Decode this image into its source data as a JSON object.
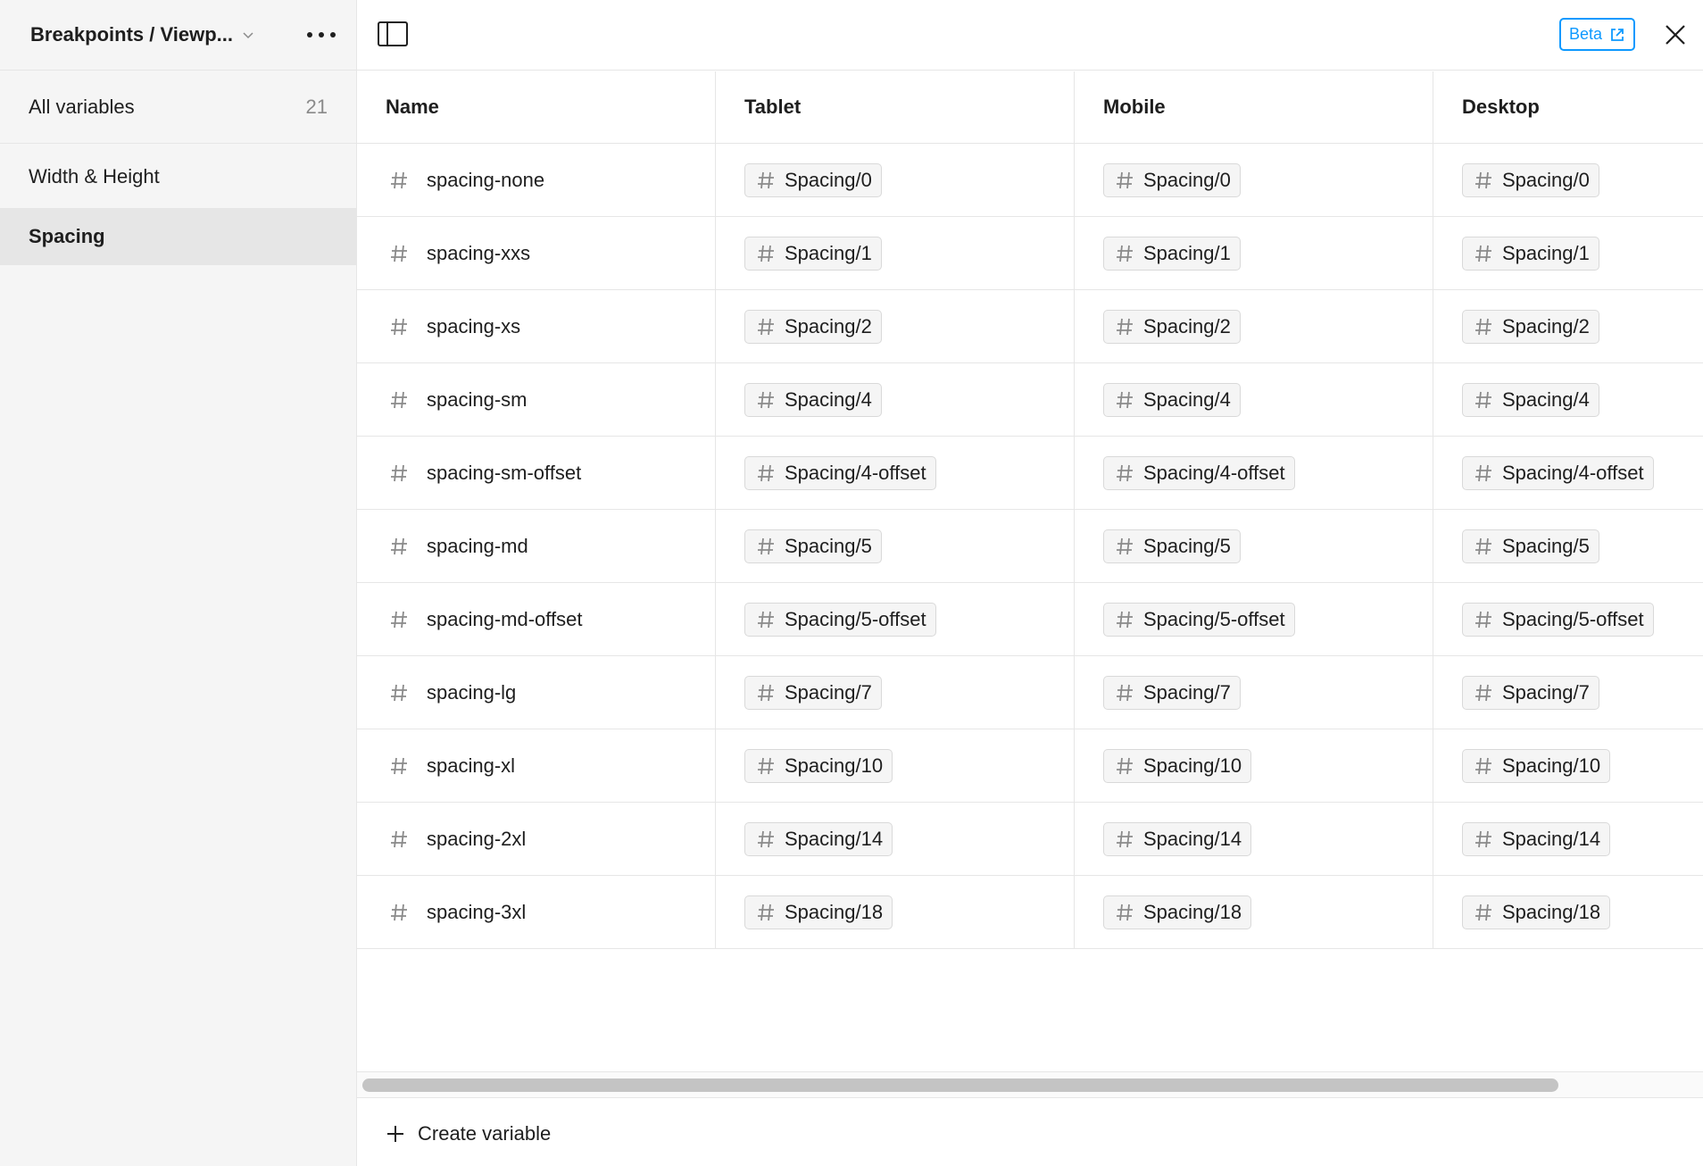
{
  "sidebar": {
    "collection_name": "Breakpoints / Viewp...",
    "all_variables_label": "All variables",
    "all_variables_count": "21",
    "groups": [
      {
        "label": "Width & Height",
        "selected": false
      },
      {
        "label": "Spacing",
        "selected": true
      }
    ]
  },
  "topbar": {
    "beta_label": "Beta"
  },
  "table": {
    "columns": [
      "Name",
      "Tablet",
      "Mobile",
      "Desktop"
    ],
    "rows": [
      {
        "name": "spacing-none",
        "tablet": "Spacing/0",
        "mobile": "Spacing/0",
        "desktop": "Spacing/0"
      },
      {
        "name": "spacing-xxs",
        "tablet": "Spacing/1",
        "mobile": "Spacing/1",
        "desktop": "Spacing/1"
      },
      {
        "name": "spacing-xs",
        "tablet": "Spacing/2",
        "mobile": "Spacing/2",
        "desktop": "Spacing/2"
      },
      {
        "name": "spacing-sm",
        "tablet": "Spacing/4",
        "mobile": "Spacing/4",
        "desktop": "Spacing/4"
      },
      {
        "name": "spacing-sm-offset",
        "tablet": "Spacing/4-offset",
        "mobile": "Spacing/4-offset",
        "desktop": "Spacing/4-offset"
      },
      {
        "name": "spacing-md",
        "tablet": "Spacing/5",
        "mobile": "Spacing/5",
        "desktop": "Spacing/5"
      },
      {
        "name": "spacing-md-offset",
        "tablet": "Spacing/5-offset",
        "mobile": "Spacing/5-offset",
        "desktop": "Spacing/5-offset"
      },
      {
        "name": "spacing-lg",
        "tablet": "Spacing/7",
        "mobile": "Spacing/7",
        "desktop": "Spacing/7"
      },
      {
        "name": "spacing-xl",
        "tablet": "Spacing/10",
        "mobile": "Spacing/10",
        "desktop": "Spacing/10"
      },
      {
        "name": "spacing-2xl",
        "tablet": "Spacing/14",
        "mobile": "Spacing/14",
        "desktop": "Spacing/14"
      },
      {
        "name": "spacing-3xl",
        "tablet": "Spacing/18",
        "mobile": "Spacing/18",
        "desktop": "Spacing/18"
      }
    ]
  },
  "footer": {
    "create_label": "Create variable"
  },
  "colors": {
    "accent": "#0d99ff",
    "sidebar_bg": "#f5f5f5",
    "selected_bg": "#e6e6e6",
    "border": "#e6e6e6"
  },
  "icons": {
    "variable_type": "hash-icon",
    "more": "more-dots-icon",
    "panel": "sidebar-toggle-icon",
    "close": "close-icon",
    "external": "external-link-icon",
    "add": "plus-icon"
  }
}
